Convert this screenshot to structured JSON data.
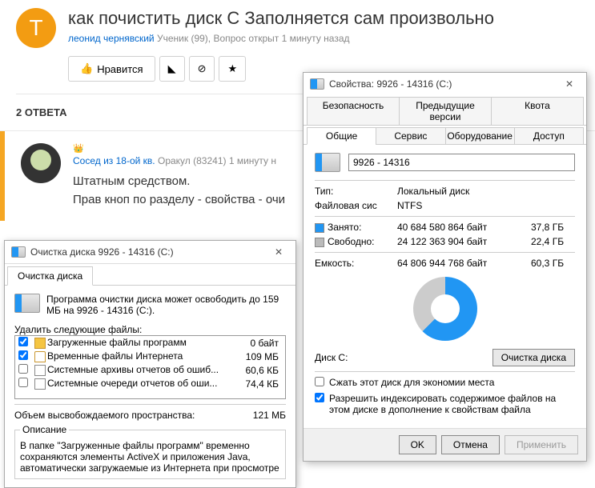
{
  "question": {
    "avatar_letter": "Т",
    "title": "как почистить диск С Заполняется сам произвольно",
    "author": "леонид чернявский",
    "rank": "Ученик (99), Вопрос открыт 1 минуту назад",
    "like_label": "Нравится",
    "answers_header": "2 ОТВЕТА"
  },
  "answer": {
    "author": "Сосед из 18-ой кв.",
    "rank": "Оракул (83241)",
    "time": "1 минуту н",
    "line1": "Штатным средством.",
    "line2": "Прав кноп по разделу - свойства - очи"
  },
  "cleanup": {
    "title": "Очистка диска 9926 - 14316 (C:)",
    "tab": "Очистка диска",
    "desc": "Программа очистки диска может освободить до 159 МБ на 9926 - 14316 (C:).",
    "list_label": "Удалить следующие файлы:",
    "files": [
      {
        "checked": true,
        "icon": "folder",
        "name": "Загруженные файлы программ",
        "size": "0 байт"
      },
      {
        "checked": true,
        "icon": "lock",
        "name": "Временные файлы Интернета",
        "size": "109 МБ"
      },
      {
        "checked": false,
        "icon": "doc",
        "name": "Системные архивы отчетов об ошиб...",
        "size": "60,6 КБ"
      },
      {
        "checked": false,
        "icon": "doc",
        "name": "Системные очереди отчетов об оши...",
        "size": "74,4 КБ"
      }
    ],
    "freed_label": "Объем высвобождаемого пространства:",
    "freed_value": "121 МБ",
    "group_title": "Описание",
    "group_text": "В папке \"Загруженные файлы программ\" временно сохраняются элементы ActiveX и приложения Java, автоматически загружаемые из Интернета при просмотре"
  },
  "props": {
    "title": "Свойства: 9926 - 14316 (C:)",
    "tabs_top": [
      "Безопасность",
      "Предыдущие версии",
      "Квота"
    ],
    "tabs_bot": [
      "Общие",
      "Сервис",
      "Оборудование",
      "Доступ"
    ],
    "active_tab": 0,
    "name_value": "9926 - 14316",
    "type_label": "Тип:",
    "type_value": "Локальный диск",
    "fs_label": "Файловая сис",
    "fs_value": "NTFS",
    "used_label": "Занято:",
    "used_bytes": "40 684 580 864 байт",
    "used_gb": "37,8 ГБ",
    "free_label": "Свободно:",
    "free_bytes": "24 122 363 904 байт",
    "free_gb": "22,4 ГБ",
    "cap_label": "Емкость:",
    "cap_bytes": "64 806 944 768 байт",
    "cap_gb": "60,3 ГБ",
    "drive_label": "Диск C:",
    "cleanup_btn": "Очистка диска",
    "opt_compress": "Сжать этот диск для экономии места",
    "opt_index": "Разрешить индексировать содержимое файлов на этом диске в дополнение к свойствам файла",
    "ok": "OK",
    "cancel": "Отмена",
    "apply": "Применить"
  }
}
